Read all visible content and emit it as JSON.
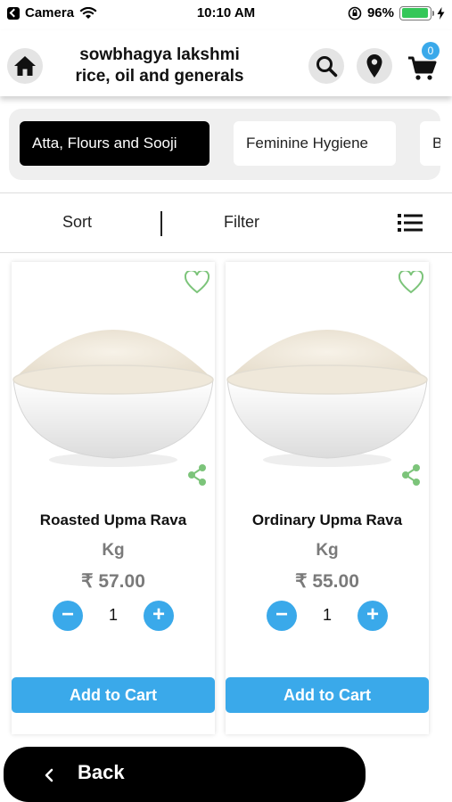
{
  "status_bar": {
    "carrier": "Camera",
    "time": "10:10 AM",
    "battery": "96%",
    "battery_level": 0.96
  },
  "header": {
    "title_line1": "sowbhagya lakshmi",
    "title_line2": "rice, oil and generals",
    "cart_count": "0",
    "icons": [
      "home-icon",
      "search-icon",
      "location-pin-icon",
      "cart-icon"
    ]
  },
  "categories": [
    {
      "label": "Atta, Flours and Sooji",
      "active": true
    },
    {
      "label": "Feminine Hygiene",
      "active": false
    },
    {
      "label": "B",
      "active": false
    }
  ],
  "toolbar": {
    "sort_label": "Sort",
    "filter_label": "Filter"
  },
  "products": [
    {
      "name": "Roasted Upma Rava",
      "unit": "Kg",
      "price": "₹ 57.00",
      "quantity": "1",
      "add_label": "Add to Cart",
      "minus": "−",
      "plus": "+"
    },
    {
      "name": "Ordinary Upma Rava",
      "unit": "Kg",
      "price": "₹ 55.00",
      "quantity": "1",
      "add_label": "Add to Cart",
      "minus": "−",
      "plus": "+"
    }
  ],
  "footer": {
    "back_label": "Back"
  },
  "colors": {
    "accent": "#3aa9ea",
    "heart_share": "#7cc47a",
    "active_chip": "#000000",
    "battery": "#35c759"
  }
}
